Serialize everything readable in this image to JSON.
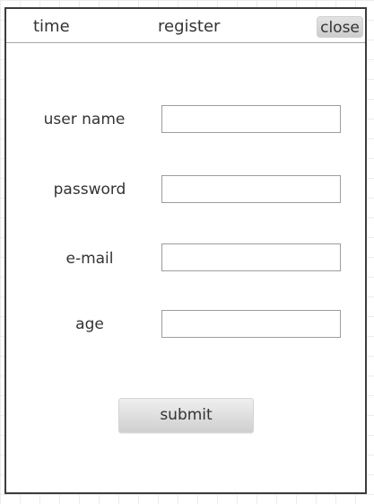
{
  "title_bar": {
    "time_label": "time",
    "title": "register",
    "close_label": "close"
  },
  "form": {
    "fields": [
      {
        "label": "user name",
        "value": "",
        "placeholder": ""
      },
      {
        "label": "password",
        "value": "",
        "placeholder": ""
      },
      {
        "label": "e-mail",
        "value": "",
        "placeholder": ""
      },
      {
        "label": "age",
        "value": "",
        "placeholder": ""
      }
    ],
    "submit_label": "submit"
  }
}
